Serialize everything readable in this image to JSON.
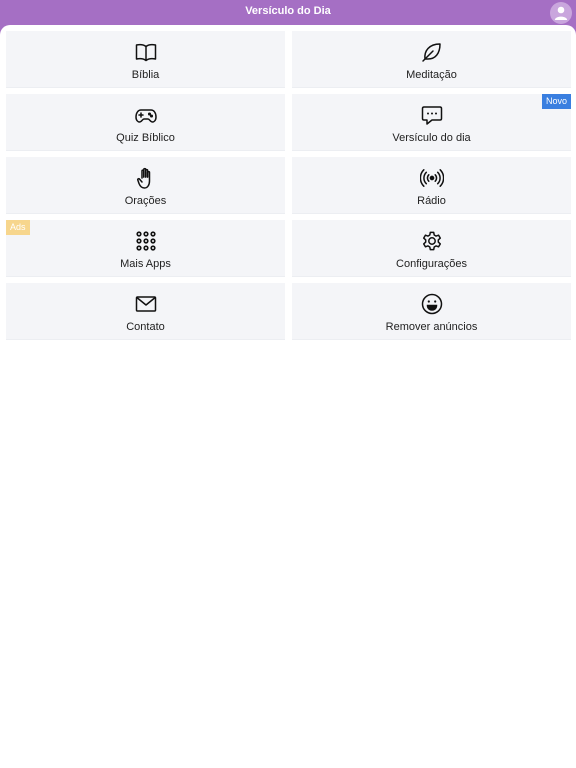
{
  "header": {
    "title": "Versículo do Dia",
    "avatar_icon": "user-icon"
  },
  "colors": {
    "header_bg": "#a56fc4",
    "tile_bg": "#f4f5f8",
    "badge_new": "#3a7fe0",
    "badge_ads": "#f7d68d"
  },
  "tiles": [
    {
      "label": "Bíblia",
      "icon": "book-icon"
    },
    {
      "label": "Meditação",
      "icon": "leaf-icon"
    },
    {
      "label": "Quiz Bíblico",
      "icon": "gamepad-icon"
    },
    {
      "label": "Versículo do dia",
      "icon": "chat-bubble-icon",
      "badge": "Novo"
    },
    {
      "label": "Orações",
      "icon": "hand-icon"
    },
    {
      "label": "Rádio",
      "icon": "broadcast-icon"
    },
    {
      "label": "Mais Apps",
      "icon": "grid-dots-icon",
      "badge": "Ads"
    },
    {
      "label": "Configurações",
      "icon": "gear-icon"
    },
    {
      "label": "Contato",
      "icon": "envelope-icon"
    },
    {
      "label": "Remover anúncios",
      "icon": "smiley-icon"
    }
  ]
}
